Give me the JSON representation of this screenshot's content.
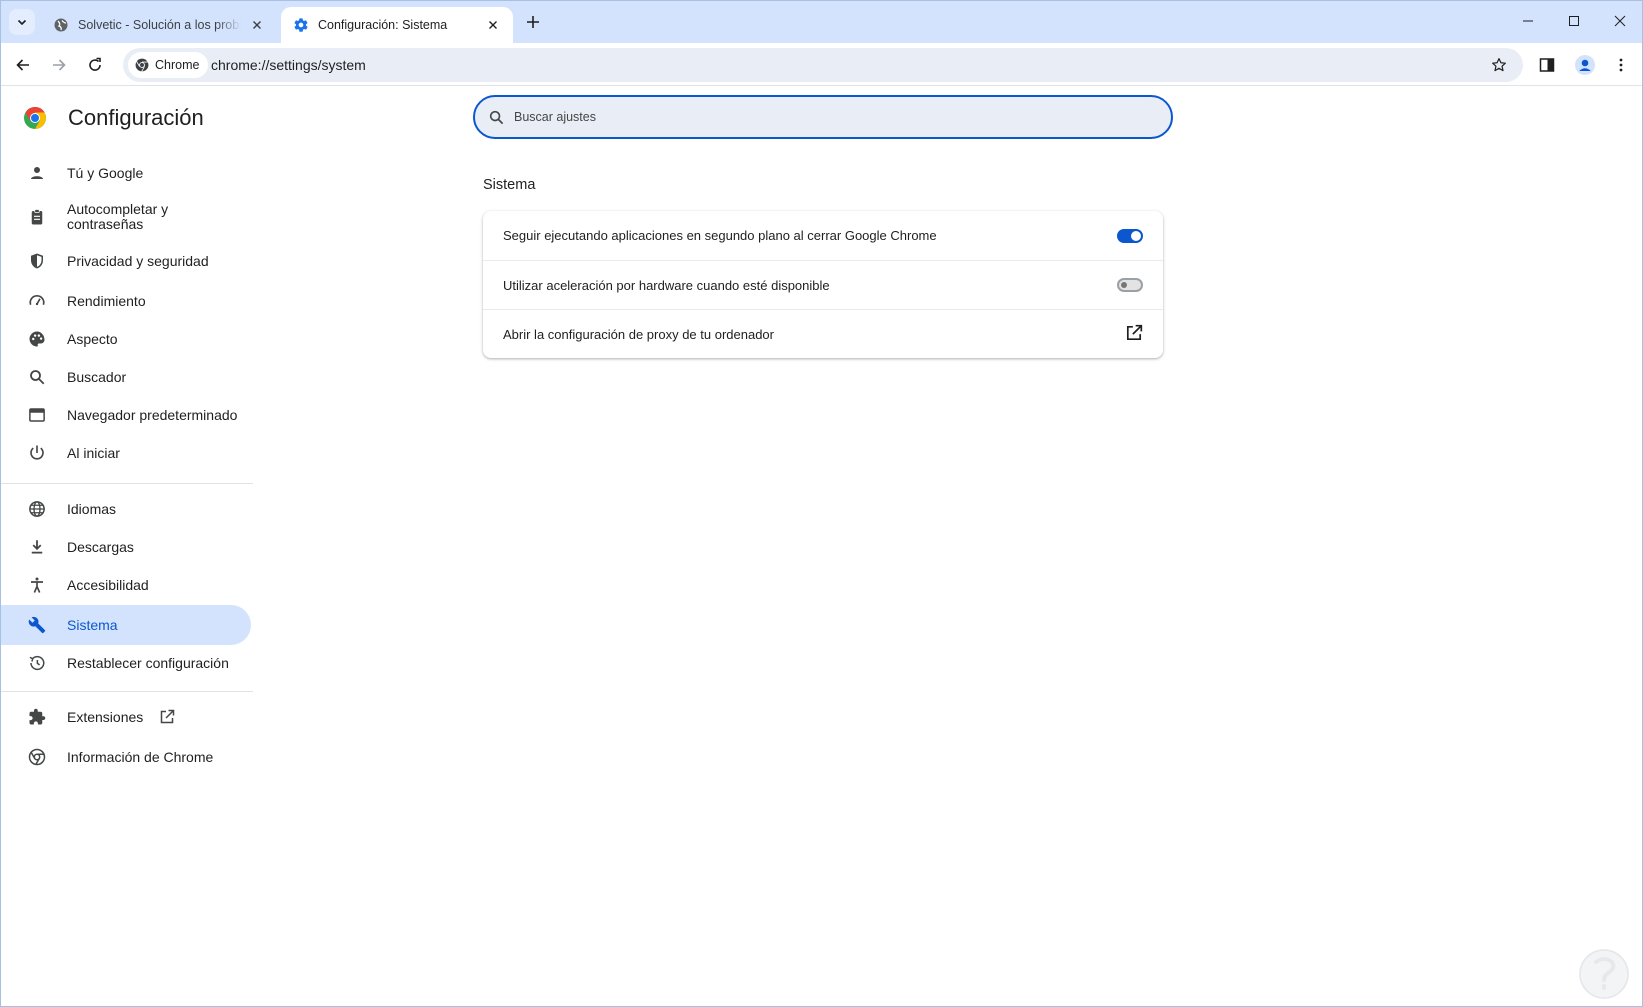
{
  "tabs": [
    {
      "title": "Solvetic - Solución a los problemas informáticos",
      "active": false
    },
    {
      "title": "Configuración: Sistema",
      "active": true
    }
  ],
  "toolbar": {
    "chip_label": "Chrome",
    "url": "chrome://settings/system"
  },
  "settings": {
    "title": "Configuración",
    "search_placeholder": "Buscar ajustes"
  },
  "sidebar": {
    "items": [
      {
        "label": "Tú y Google",
        "icon": "person-icon"
      },
      {
        "label": "Autocompletar y contraseñas",
        "icon": "clipboard-icon"
      },
      {
        "label": "Privacidad y seguridad",
        "icon": "shield-icon"
      },
      {
        "label": "Rendimiento",
        "icon": "speedometer-icon"
      },
      {
        "label": "Aspecto",
        "icon": "palette-icon"
      },
      {
        "label": "Buscador",
        "icon": "search-icon"
      },
      {
        "label": "Navegador predeterminado",
        "icon": "browser-window-icon"
      },
      {
        "label": "Al iniciar",
        "icon": "power-icon"
      },
      {
        "label": "Idiomas",
        "icon": "globe-icon"
      },
      {
        "label": "Descargas",
        "icon": "download-icon"
      },
      {
        "label": "Accesibilidad",
        "icon": "accessibility-icon"
      },
      {
        "label": "Sistema",
        "icon": "wrench-icon",
        "active": true
      },
      {
        "label": "Restablecer configuración",
        "icon": "restore-icon"
      },
      {
        "label": "Extensiones",
        "icon": "puzzle-icon"
      },
      {
        "label": "Información de Chrome",
        "icon": "chrome-icon"
      }
    ]
  },
  "main": {
    "section_title": "Sistema",
    "rows": [
      {
        "label": "Seguir ejecutando aplicaciones en segundo plano al cerrar Google Chrome",
        "control": "toggle",
        "enabled": true
      },
      {
        "label": "Utilizar aceleración por hardware cuando esté disponible",
        "control": "toggle",
        "enabled": false
      },
      {
        "label": "Abrir la configuración de proxy de tu ordenador",
        "control": "external-link-icon"
      }
    ]
  },
  "colors": {
    "accent": "#0b57d0",
    "tabstrip": "#d3e3fd",
    "active_nav_bg": "#d3e3fd",
    "omnibox_bg": "#e9eef6"
  }
}
